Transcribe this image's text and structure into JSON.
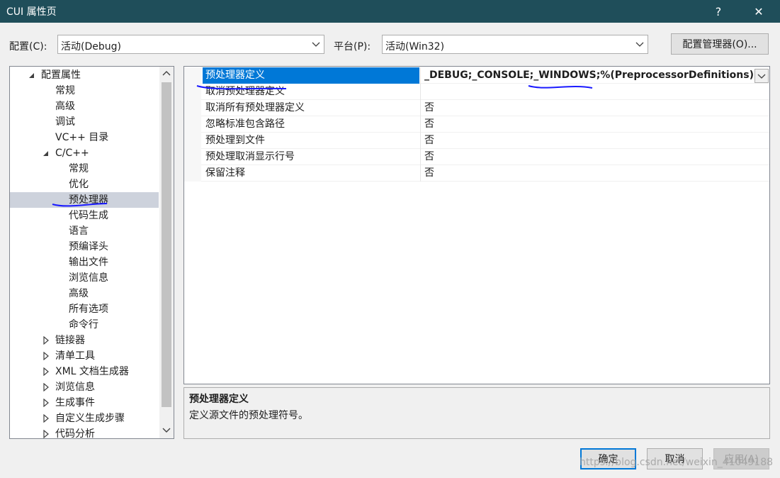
{
  "window": {
    "title": "CUI 属性页",
    "help_glyph": "?",
    "close_glyph": "✕"
  },
  "toolbar": {
    "config_label": "配置(C):",
    "config_value": "活动(Debug)",
    "platform_label": "平台(P):",
    "platform_value": "活动(Win32)",
    "config_manager_label": "配置管理器(O)..."
  },
  "tree": {
    "items": [
      {
        "label": "配置属性",
        "level": 0,
        "expander": "expanded"
      },
      {
        "label": "常规",
        "level": 1
      },
      {
        "label": "高级",
        "level": 1
      },
      {
        "label": "调试",
        "level": 1
      },
      {
        "label": "VC++ 目录",
        "level": 1
      },
      {
        "label": "C/C++",
        "level": 1,
        "expander": "expanded"
      },
      {
        "label": "常规",
        "level": 2
      },
      {
        "label": "优化",
        "level": 2
      },
      {
        "label": "预处理器",
        "level": 2,
        "selected": true
      },
      {
        "label": "代码生成",
        "level": 2
      },
      {
        "label": "语言",
        "level": 2
      },
      {
        "label": "预编译头",
        "level": 2
      },
      {
        "label": "输出文件",
        "level": 2
      },
      {
        "label": "浏览信息",
        "level": 2
      },
      {
        "label": "高级",
        "level": 2
      },
      {
        "label": "所有选项",
        "level": 2
      },
      {
        "label": "命令行",
        "level": 2
      },
      {
        "label": "链接器",
        "level": 1,
        "expander": "collapsed"
      },
      {
        "label": "清单工具",
        "level": 1,
        "expander": "collapsed"
      },
      {
        "label": "XML 文档生成器",
        "level": 1,
        "expander": "collapsed"
      },
      {
        "label": "浏览信息",
        "level": 1,
        "expander": "collapsed"
      },
      {
        "label": "生成事件",
        "level": 1,
        "expander": "collapsed"
      },
      {
        "label": "自定义生成步骤",
        "level": 1,
        "expander": "collapsed"
      },
      {
        "label": "代码分析",
        "level": 1,
        "expander": "collapsed"
      }
    ]
  },
  "grid": {
    "rows": [
      {
        "name": "预处理器定义",
        "value": "_DEBUG;_CONSOLE;_WINDOWS;%(PreprocessorDefinitions)",
        "selected": true
      },
      {
        "name": "取消预处理器定义",
        "value": ""
      },
      {
        "name": "取消所有预处理器定义",
        "value": "否"
      },
      {
        "name": "忽略标准包含路径",
        "value": "否"
      },
      {
        "name": "预处理到文件",
        "value": "否"
      },
      {
        "name": "预处理取消显示行号",
        "value": "否"
      },
      {
        "name": "保留注释",
        "value": "否"
      }
    ]
  },
  "description": {
    "title": "预处理器定义",
    "text": "定义源文件的预处理符号。"
  },
  "buttons": {
    "ok": "确定",
    "cancel": "取消",
    "apply": "应用(A)"
  },
  "watermark": "https://blog.csdn.net/weixin_41049188",
  "colors": {
    "titlebar": "#1f4e5a",
    "selection": "#0078d7",
    "tree_selection": "#cdd2dc",
    "annotation": "#1a1aff"
  }
}
